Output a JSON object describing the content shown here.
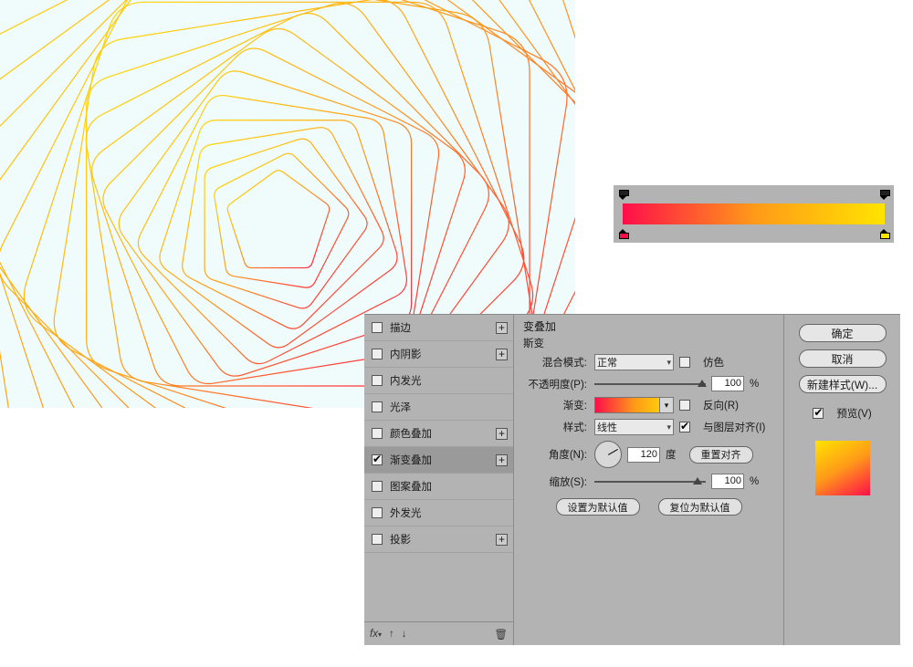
{
  "colors": {
    "grad_start": "#ff0e49",
    "grad_mid": "#ff9919",
    "grad_end": "#ffe400"
  },
  "effects": [
    {
      "label": "描边",
      "checked": false,
      "plus": true,
      "dark": false
    },
    {
      "label": "内阴影",
      "checked": false,
      "plus": true,
      "dark": false
    },
    {
      "label": "内发光",
      "checked": false,
      "plus": false,
      "dark": false
    },
    {
      "label": "光泽",
      "checked": false,
      "plus": false,
      "dark": false
    },
    {
      "label": "颜色叠加",
      "checked": false,
      "plus": true,
      "dark": false
    },
    {
      "label": "渐变叠加",
      "checked": true,
      "plus": true,
      "dark": true
    },
    {
      "label": "图案叠加",
      "checked": false,
      "plus": false,
      "dark": false
    },
    {
      "label": "外发光",
      "checked": false,
      "plus": false,
      "dark": false
    },
    {
      "label": "投影",
      "checked": false,
      "plus": true,
      "dark": false
    }
  ],
  "settings": {
    "title1": "变叠加",
    "title2": "斯变",
    "blend_label": "混合模式:",
    "blend_value": "正常",
    "dither_label": "仿色",
    "opacity_label": "不透明度(P):",
    "opacity_value": "100",
    "pct": "%",
    "gradient_label": "渐变:",
    "reverse_label": "反向(R)",
    "style_label": "样式:",
    "style_value": "线性",
    "align_label": "与图层对齐(I)",
    "angle_label": "角度(N):",
    "angle_value": "120",
    "deg": "度",
    "reset_align": "重置对齐",
    "scale_label": "缩放(S):",
    "scale_value": "100",
    "set_default": "设置为默认值",
    "reset_default": "复位为默认值"
  },
  "buttons": {
    "ok": "确定",
    "cancel": "取消",
    "new_style": "新建样式(W)...",
    "preview": "预览(V)"
  },
  "fx_footer": {
    "fx": "fx",
    "up": "✦",
    "down": "✦"
  }
}
